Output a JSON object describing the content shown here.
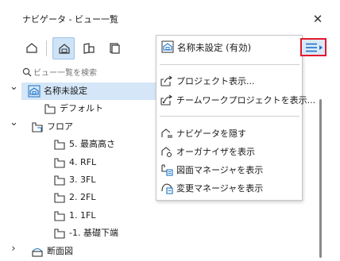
{
  "window": {
    "title": "ナビゲータ - ビュー一覧",
    "close_icon": "close-icon"
  },
  "toolbar": {
    "buttons": [
      {
        "icon": "project-map-icon"
      },
      {
        "icon": "view-map-icon",
        "active": true
      },
      {
        "icon": "layout-book-icon"
      },
      {
        "icon": "publisher-sets-icon"
      }
    ]
  },
  "search": {
    "placeholder": "ビュー一覧を検索",
    "value": ""
  },
  "tree": {
    "items": [
      {
        "label": "名称未設定",
        "level": 0,
        "expand": "expanded",
        "icon": "view-map-root-icon",
        "selected": true
      },
      {
        "label": "デフォルト",
        "level": 1,
        "expand": "none",
        "icon": "view-icon"
      },
      {
        "label": "フロア",
        "level": 0.6,
        "expand": "expanded",
        "icon": "view-folder-icon"
      },
      {
        "label": "5. 最高高さ",
        "level": 2,
        "expand": "none",
        "icon": "view-icon"
      },
      {
        "label": "4. RFL",
        "level": 2,
        "expand": "none",
        "icon": "view-icon"
      },
      {
        "label": "3. 3FL",
        "level": 2,
        "expand": "none",
        "icon": "view-icon"
      },
      {
        "label": "2. 2FL",
        "level": 2,
        "expand": "none",
        "icon": "view-icon"
      },
      {
        "label": "1. 1FL",
        "level": 2,
        "expand": "none",
        "icon": "view-icon"
      },
      {
        "label": "-1. 基礎下端",
        "level": 2,
        "expand": "none",
        "icon": "view-icon"
      },
      {
        "label": "断面図",
        "level": 0.6,
        "expand": "collapsed",
        "icon": "section-folder-icon"
      }
    ]
  },
  "dropdown": {
    "header": {
      "label": "名称未設定 (有効)",
      "icon": "view-map-root-icon"
    },
    "group1": [
      {
        "label": "プロジェクト表示...",
        "icon": "open-project-icon"
      },
      {
        "label": "チームワークプロジェクトを表示...",
        "icon": "open-teamwork-icon"
      }
    ],
    "group2": [
      {
        "label": "ナビゲータを隠す",
        "icon": "hide-navigator-icon"
      },
      {
        "label": "オーガナイザを表示",
        "icon": "organizer-icon"
      },
      {
        "label": "図面マネージャを表示",
        "icon": "drawing-manager-icon"
      },
      {
        "label": "変更マネージャを表示",
        "icon": "change-manager-icon"
      }
    ]
  },
  "menu_button": {
    "icon": "hamburger-menu-icon"
  },
  "colors": {
    "accent": "#1a73c8",
    "highlight": "#d4e6f7",
    "menu_outline": "#e0192e"
  }
}
